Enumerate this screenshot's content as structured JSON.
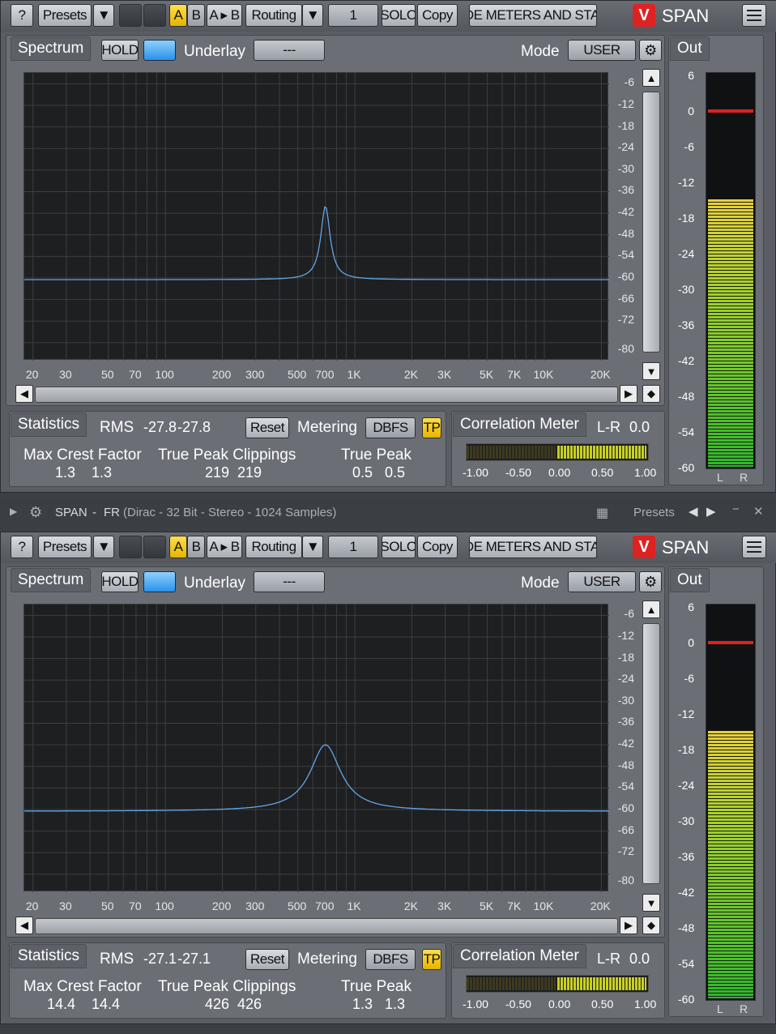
{
  "toolbar": {
    "help": "?",
    "presets": "Presets",
    "a": "A",
    "b": "B",
    "ab": "A ▸ B",
    "routing": "Routing",
    "channel": "1",
    "solo": "SOLO",
    "copy": "Copy",
    "hide": "HIDE METERS AND STATS",
    "brand": "SPAN"
  },
  "spectrum": {
    "tab": "Spectrum",
    "hold": "HOLD",
    "underlay": "Underlay",
    "underlay_value": "---",
    "mode_label": "Mode",
    "mode_value": "USER"
  },
  "out_label": "Out",
  "yaxis": [
    "-6",
    "-12",
    "-18",
    "-24",
    "-30",
    "-36",
    "-42",
    "-48",
    "-54",
    "-60",
    "-66",
    "-72",
    "-80"
  ],
  "xaxis": [
    "20",
    "30",
    "50",
    "70",
    "100",
    "200",
    "300",
    "500",
    "700",
    "1K",
    "2K",
    "3K",
    "5K",
    "7K",
    "10K",
    "20K"
  ],
  "out_scale": [
    "6",
    "0",
    "-6",
    "-12",
    "-18",
    "-24",
    "-30",
    "-36",
    "-42",
    "-48",
    "-54",
    "-60"
  ],
  "stats_labels": {
    "statistics": "Statistics",
    "rms": "RMS",
    "reset": "Reset",
    "metering": "Metering",
    "dbfs": "DBFS",
    "tp": "TP",
    "correlation": "Correlation Meter",
    "lr": "L-R",
    "max_crest": "Max Crest Factor",
    "tp_clip": "True Peak Clippings",
    "true_peak": "True Peak"
  },
  "corr_scale": [
    "-1.00",
    "-0.50",
    "0.00",
    "0.50",
    "1.00"
  ],
  "lr_labels": {
    "l": "L",
    "r": "R"
  },
  "host": {
    "title": "SPAN",
    "sep": "-",
    "preset": "FR",
    "info": "(Dirac - 32 Bit - Stereo - 1024 Samples)",
    "presets": "Presets"
  },
  "instances": [
    {
      "rms_l": "-27.8",
      "rms_r": "-27.8",
      "corr": "0.0",
      "crest_l": "1.3",
      "crest_r": "1.3",
      "clip_l": "219",
      "clip_r": "219",
      "peak_l": "0.5",
      "peak_r": "0.5",
      "peak_db": -40,
      "meter_level_db": -15
    },
    {
      "rms_l": "-27.1",
      "rms_r": "-27.1",
      "corr": "0.0",
      "crest_l": "14.4",
      "crest_r": "14.4",
      "clip_l": "426",
      "clip_r": "426",
      "peak_l": "1.3",
      "peak_r": "1.3",
      "peak_db": -42,
      "meter_level_db": -15
    }
  ]
}
